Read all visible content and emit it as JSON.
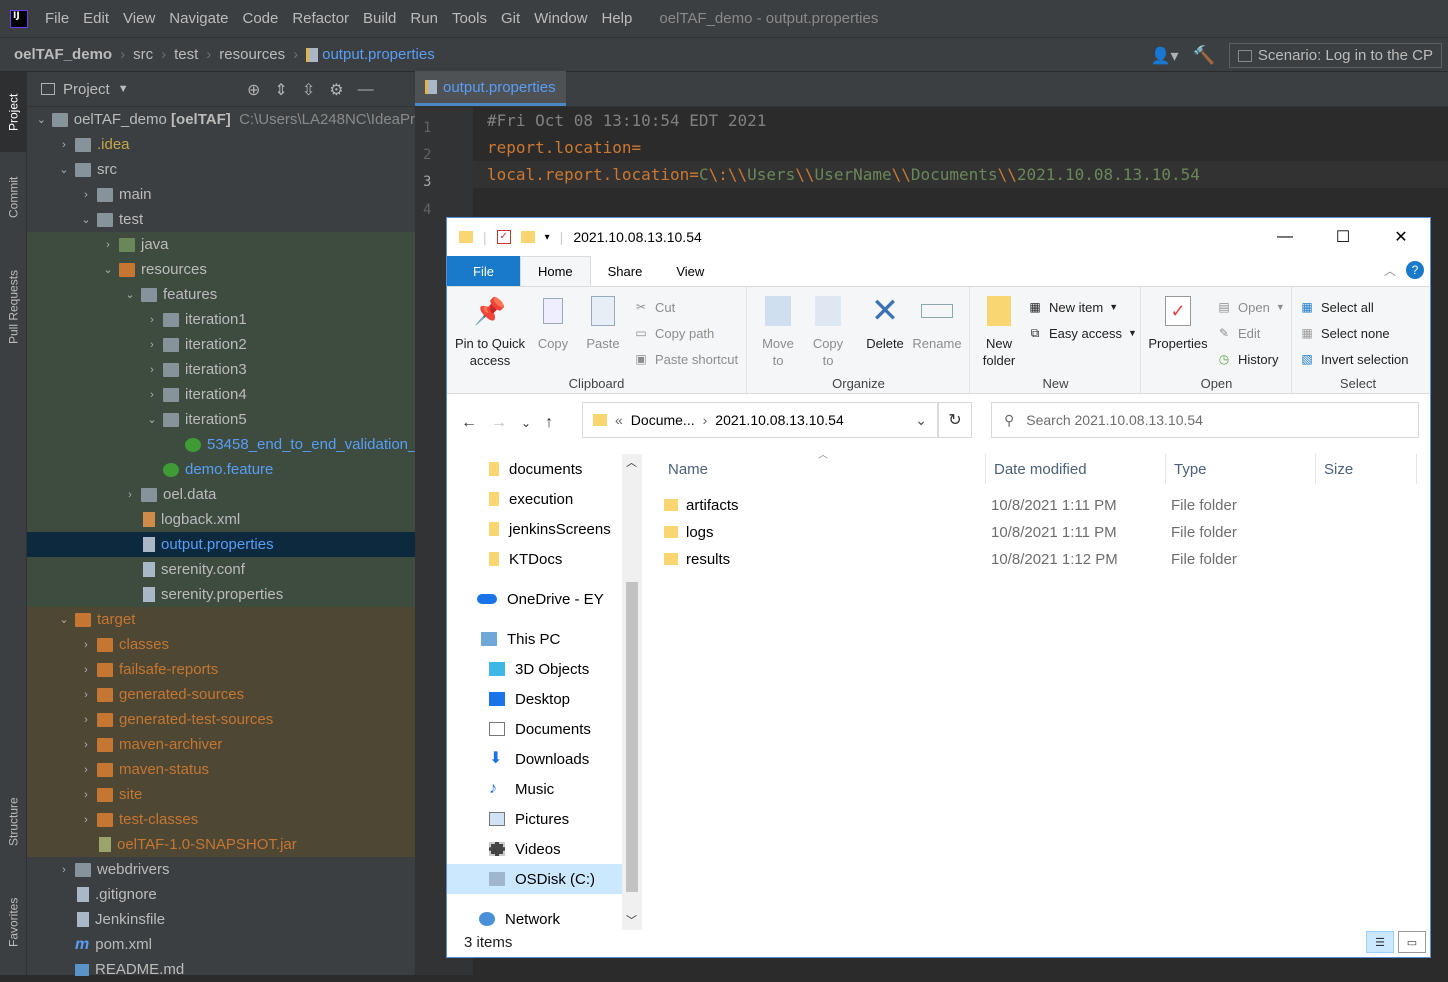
{
  "menubar": {
    "items": [
      "File",
      "Edit",
      "View",
      "Navigate",
      "Code",
      "Refactor",
      "Build",
      "Run",
      "Tools",
      "Git",
      "Window",
      "Help"
    ],
    "window_title": "oelTAF_demo - output.properties"
  },
  "navbar": {
    "crumbs": [
      "oelTAF_demo",
      "src",
      "test",
      "resources",
      "output.properties"
    ],
    "scenario": "Scenario: Log in to the CP"
  },
  "left_toolwindows": [
    "Project",
    "Commit",
    "Pull Requests",
    "Structure",
    "Favorites"
  ],
  "project_panel": {
    "title": "Project",
    "tree": [
      {
        "label": "oelTAF_demo",
        "bold": "[oelTAF]",
        "path": "C:\\Users\\LA248NC\\IdeaPr"
      },
      {
        "label": ".idea"
      },
      {
        "label": "src"
      },
      {
        "label": "main"
      },
      {
        "label": "test"
      },
      {
        "label": "java"
      },
      {
        "label": "resources"
      },
      {
        "label": "features"
      },
      {
        "label": "iteration1"
      },
      {
        "label": "iteration2"
      },
      {
        "label": "iteration3"
      },
      {
        "label": "iteration4"
      },
      {
        "label": "iteration5"
      },
      {
        "label": "53458_end_to_end_validation_"
      },
      {
        "label": "demo.feature"
      },
      {
        "label": "oel.data"
      },
      {
        "label": "logback.xml"
      },
      {
        "label": "output.properties"
      },
      {
        "label": "serenity.conf"
      },
      {
        "label": "serenity.properties"
      },
      {
        "label": "target"
      },
      {
        "label": "classes"
      },
      {
        "label": "failsafe-reports"
      },
      {
        "label": "generated-sources"
      },
      {
        "label": "generated-test-sources"
      },
      {
        "label": "maven-archiver"
      },
      {
        "label": "maven-status"
      },
      {
        "label": "site"
      },
      {
        "label": "test-classes"
      },
      {
        "label": "oelTAF-1.0-SNAPSHOT.jar"
      },
      {
        "label": "webdrivers"
      },
      {
        "label": ".gitignore"
      },
      {
        "label": "Jenkinsfile"
      },
      {
        "label": "pom.xml"
      },
      {
        "label": "README.md"
      }
    ]
  },
  "editor": {
    "tab": "output.properties",
    "line_numbers": [
      "1",
      "2",
      "3",
      "4"
    ],
    "lines": {
      "l1": "#Fri Oct 08 13:10:54 EDT 2021",
      "l2_key": "report.location",
      "l2_eq": "=",
      "l3_key": "local.report.location",
      "l3_eq": "=",
      "l3_c": "C",
      "l3_s1": "\\:\\\\",
      "l3_users": "Users",
      "l3_s2": "\\\\",
      "l3_user": "UserName",
      "l3_s3": "\\\\",
      "l3_docs": "Documents",
      "l3_s4": "\\\\",
      "l3_date": "2021.10.08.13.10.54"
    }
  },
  "explorer": {
    "title": "2021.10.08.13.10.54",
    "ribbon_tabs": [
      "File",
      "Home",
      "Share",
      "View"
    ],
    "clipboard": {
      "pin": "Pin to Quick access",
      "copy": "Copy",
      "paste": "Paste",
      "cut": "Cut",
      "copy_path": "Copy path",
      "paste_shortcut": "Paste shortcut",
      "label": "Clipboard"
    },
    "organize": {
      "move_to": "Move to",
      "copy_to": "Copy to",
      "delete": "Delete",
      "rename": "Rename",
      "label": "Organize"
    },
    "new": {
      "new_folder": "New folder",
      "new_item": "New item",
      "easy_access": "Easy access",
      "label": "New"
    },
    "open": {
      "properties": "Properties",
      "open": "Open",
      "edit": "Edit",
      "history": "History",
      "label": "Open"
    },
    "select": {
      "select_all": "Select all",
      "select_none": "Select none",
      "invert": "Invert selection",
      "label": "Select"
    },
    "address": {
      "prefix": "«",
      "part1": "Docume...",
      "part2": "2021.10.08.13.10.54"
    },
    "search_placeholder": "Search 2021.10.08.13.10.54",
    "nav_items": [
      "documents",
      "execution",
      "jenkinsScreens",
      "KTDocs",
      "OneDrive - EY",
      "This PC",
      "3D Objects",
      "Desktop",
      "Documents",
      "Downloads",
      "Music",
      "Pictures",
      "Videos",
      "OSDisk (C:)",
      "Network"
    ],
    "columns": {
      "name": "Name",
      "date": "Date modified",
      "type": "Type",
      "size": "Size"
    },
    "files": [
      {
        "name": "artifacts",
        "date": "10/8/2021 1:11 PM",
        "type": "File folder"
      },
      {
        "name": "logs",
        "date": "10/8/2021 1:11 PM",
        "type": "File folder"
      },
      {
        "name": "results",
        "date": "10/8/2021 1:12 PM",
        "type": "File folder"
      }
    ],
    "status": "3 items"
  }
}
